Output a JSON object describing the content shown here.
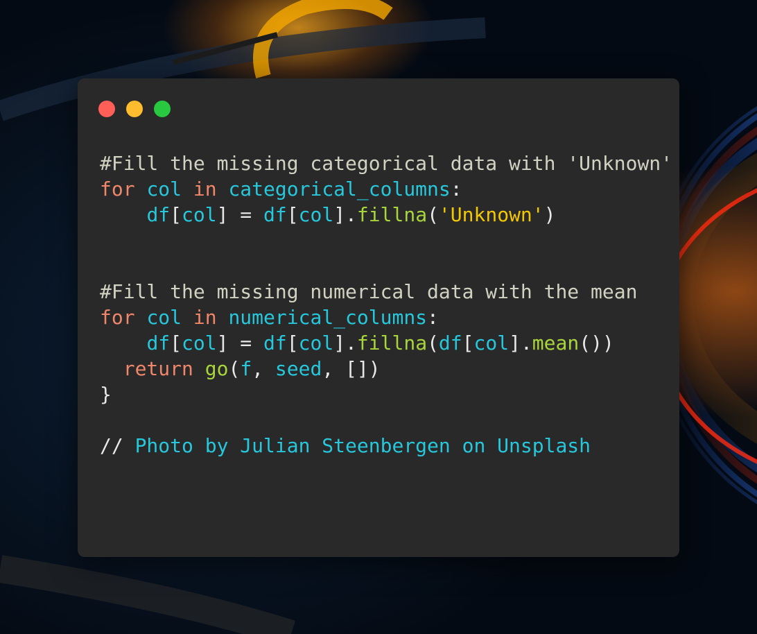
{
  "window": {
    "buttons": {
      "close": "red-dot",
      "minimize": "yellow-dot",
      "zoom": "green-dot"
    }
  },
  "code": {
    "comment1": "#Fill the missing categorical data with 'Unknown'",
    "for_kw": "for",
    "col": "col",
    "in_kw": "in",
    "cat_cols": "categorical_columns",
    "colon": ":",
    "indent": "    ",
    "df": "df",
    "lbr": "[",
    "rbr": "]",
    "eq": " = ",
    "dot": ".",
    "fillna": "fillna",
    "lpar": "(",
    "rpar": ")",
    "unknown_str": "'Unknown'",
    "comment2": "#Fill the missing numerical data with the mean",
    "num_cols": "numerical_columns",
    "mean": "mean",
    "call_close": "())",
    "return_indent": "  ",
    "return_kw": "return",
    "go": "go",
    "f": "f",
    "comma": ", ",
    "seed": "seed",
    "empty_list": "[])",
    "close_brace": "}",
    "caption_prefix": "// ",
    "caption": "Photo by Julian Steenbergen on Unsplash"
  },
  "colors": {
    "window_bg": "#292929",
    "comment": "#d2d2c2",
    "keyword": "#f0876a",
    "identifier": "#27c7dc",
    "function": "#a8d53c",
    "string": "#f4c800",
    "close": "#ff5f57",
    "minimize": "#febc2e",
    "zoom": "#28c840"
  }
}
